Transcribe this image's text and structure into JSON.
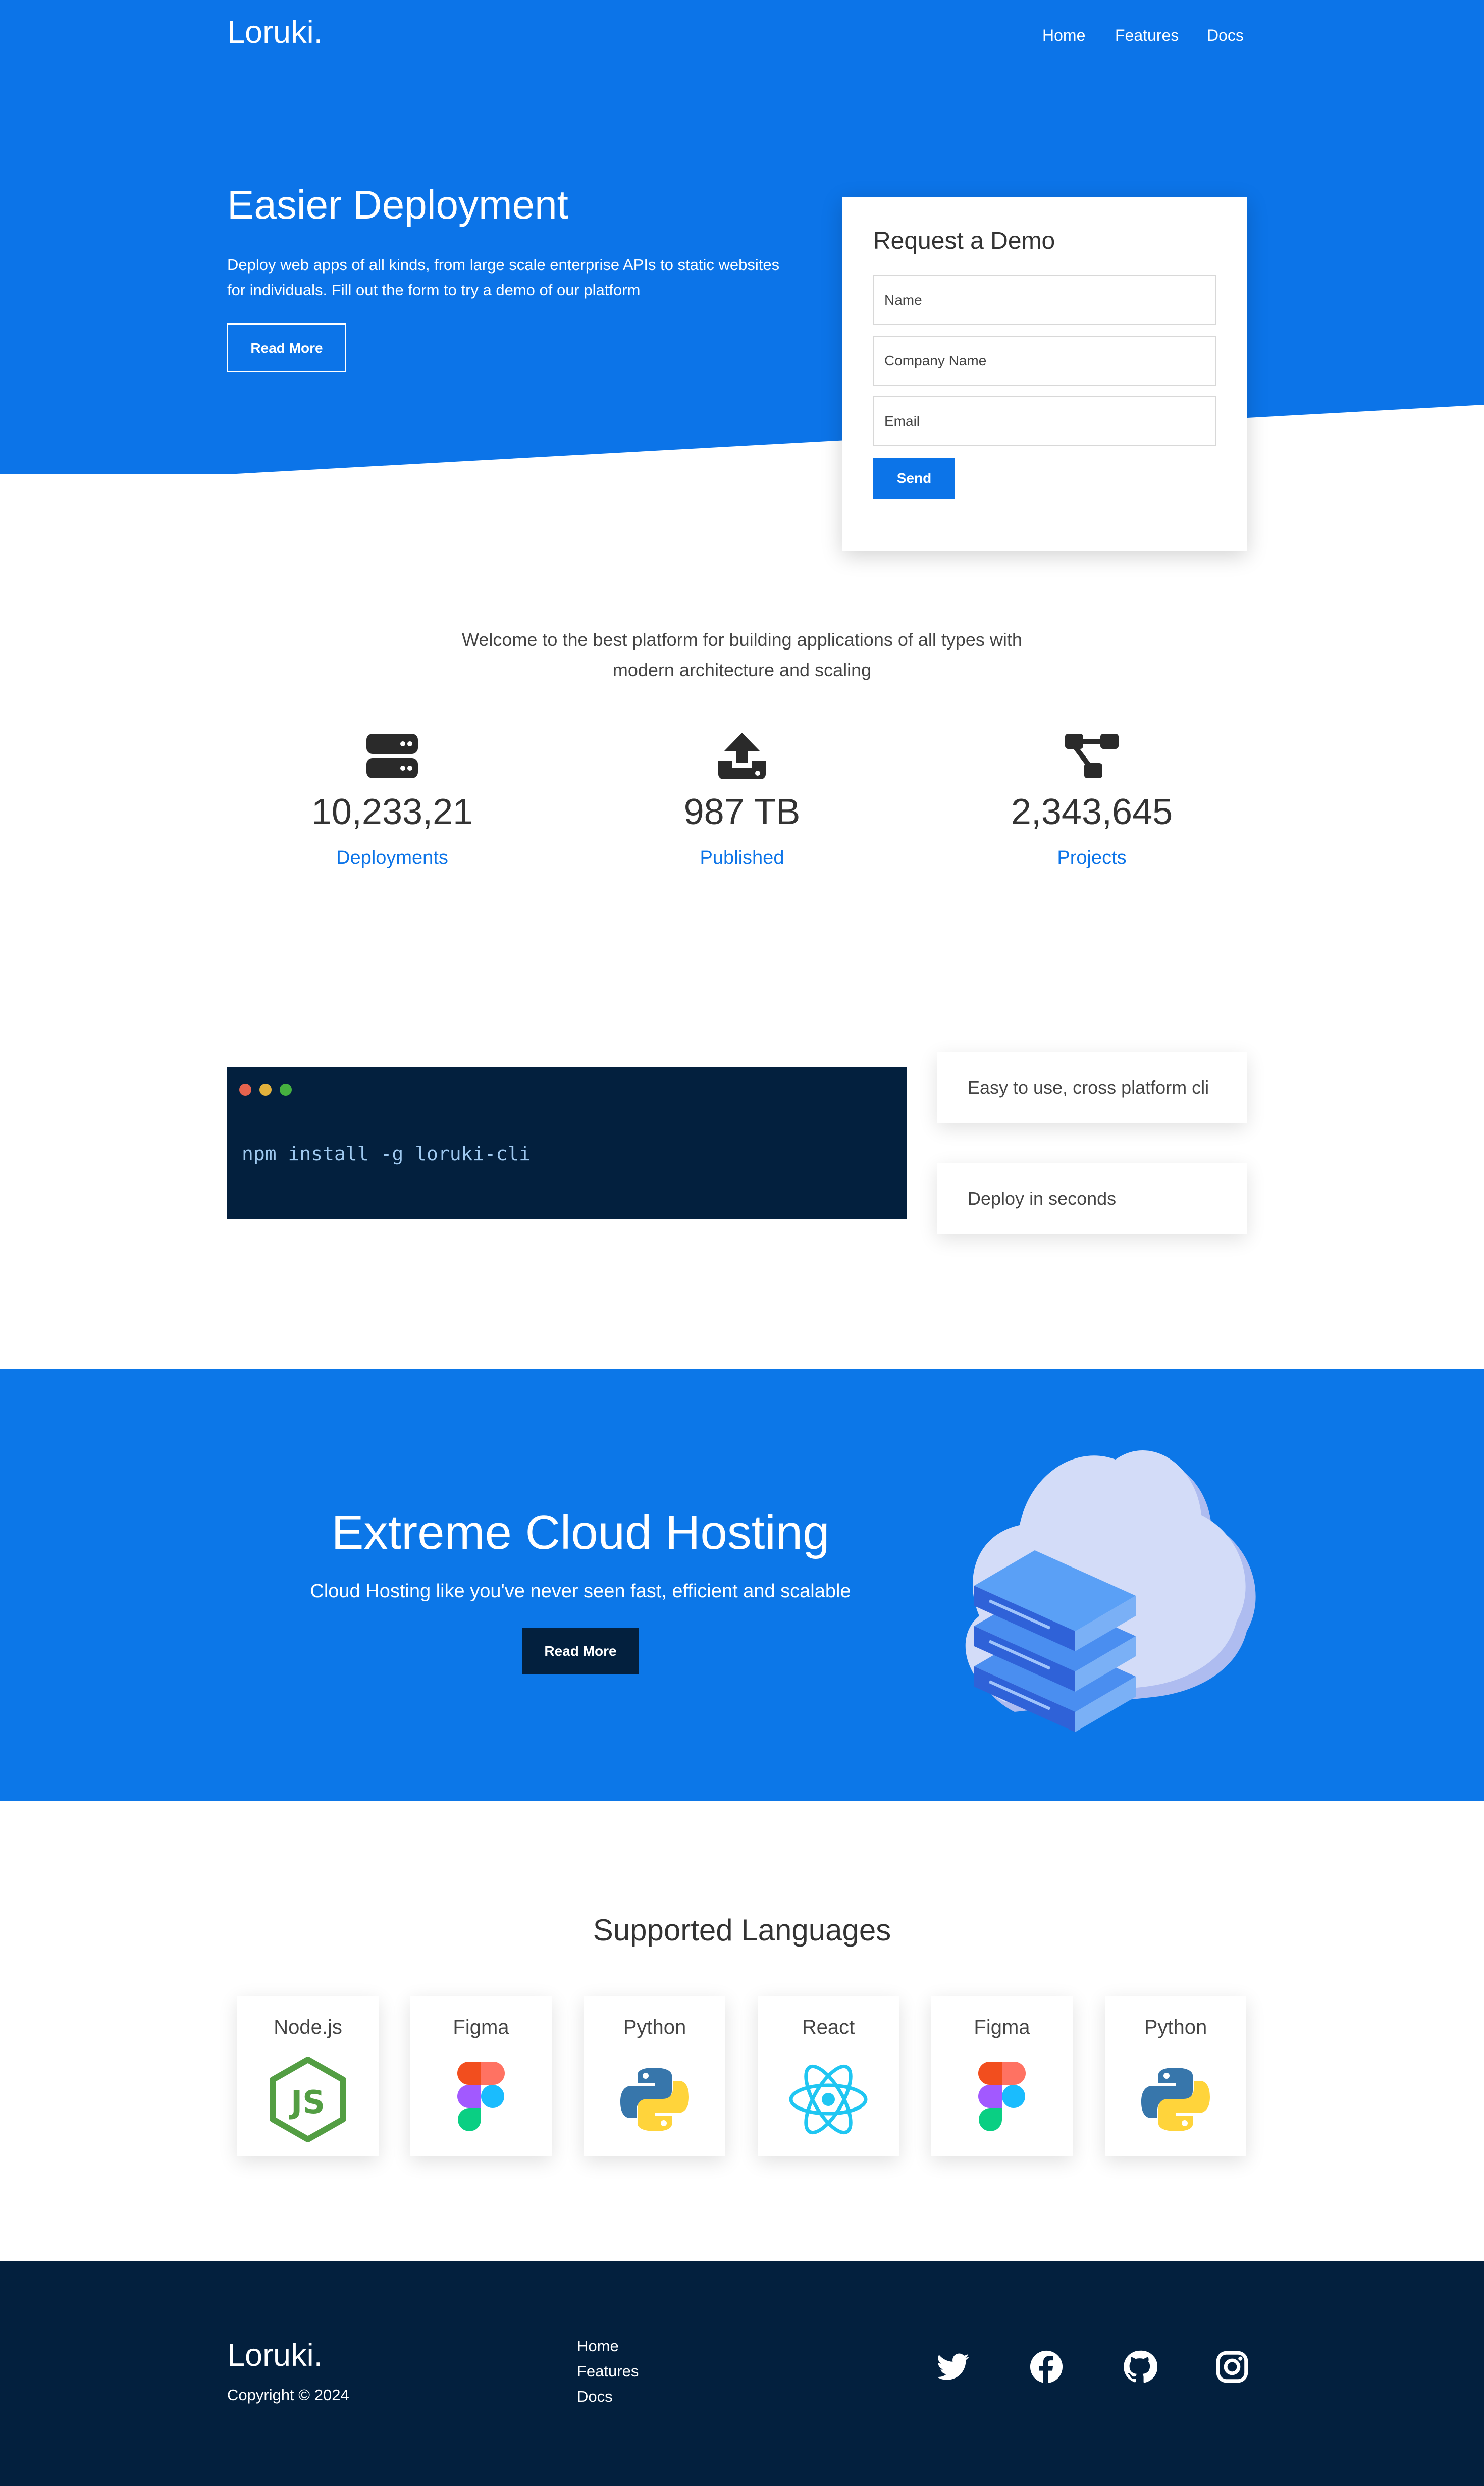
{
  "header": {
    "logo": "Loruki.",
    "nav": [
      "Home",
      "Features",
      "Docs"
    ]
  },
  "hero": {
    "title": "Easier Deployment",
    "text": "Deploy web apps of all kinds, from large scale enterprise APIs to static websites for individuals. Fill out the form to try a demo of our platform",
    "button": "Read More"
  },
  "demo_form": {
    "title": "Request a Demo",
    "fields": [
      {
        "placeholder": "Name",
        "value": ""
      },
      {
        "placeholder": "Company Name",
        "value": ""
      },
      {
        "placeholder": "Email",
        "value": ""
      }
    ],
    "submit": "Send"
  },
  "stats": {
    "intro": "Welcome to the best platform for building applications of all types with modern architecture and scaling",
    "items": [
      {
        "icon": "server-icon",
        "value": "10,233,21",
        "label": "Deployments"
      },
      {
        "icon": "upload-icon",
        "value": "987 TB",
        "label": "Published"
      },
      {
        "icon": "project-diagram-icon",
        "value": "2,343,645",
        "label": "Projects"
      }
    ]
  },
  "cli": {
    "command": "npm install -g loruki-cli",
    "features": [
      "Easy to use, cross platform cli",
      "Deploy in seconds"
    ]
  },
  "cloud": {
    "title": "Extreme Cloud Hosting",
    "subtitle": "Cloud Hosting like you've never seen fast, efficient and scalable",
    "button": "Read More"
  },
  "languages": {
    "title": "Supported Languages",
    "items": [
      {
        "name": "Node.js",
        "icon": "nodejs-icon"
      },
      {
        "name": "Figma",
        "icon": "figma-icon"
      },
      {
        "name": "Python",
        "icon": "python-icon"
      },
      {
        "name": "React",
        "icon": "react-icon"
      },
      {
        "name": "Figma",
        "icon": "figma-icon"
      },
      {
        "name": "Python",
        "icon": "python-icon"
      }
    ]
  },
  "footer": {
    "logo": "Loruki.",
    "copyright": "Copyright © 2024",
    "links": [
      "Home",
      "Features",
      "Docs"
    ],
    "social": [
      "twitter-icon",
      "facebook-icon",
      "github-icon",
      "instagram-icon"
    ]
  },
  "colors": {
    "primary": "#0c74e8",
    "dark": "#03203e",
    "terminal_text": "#9ec8ef"
  }
}
